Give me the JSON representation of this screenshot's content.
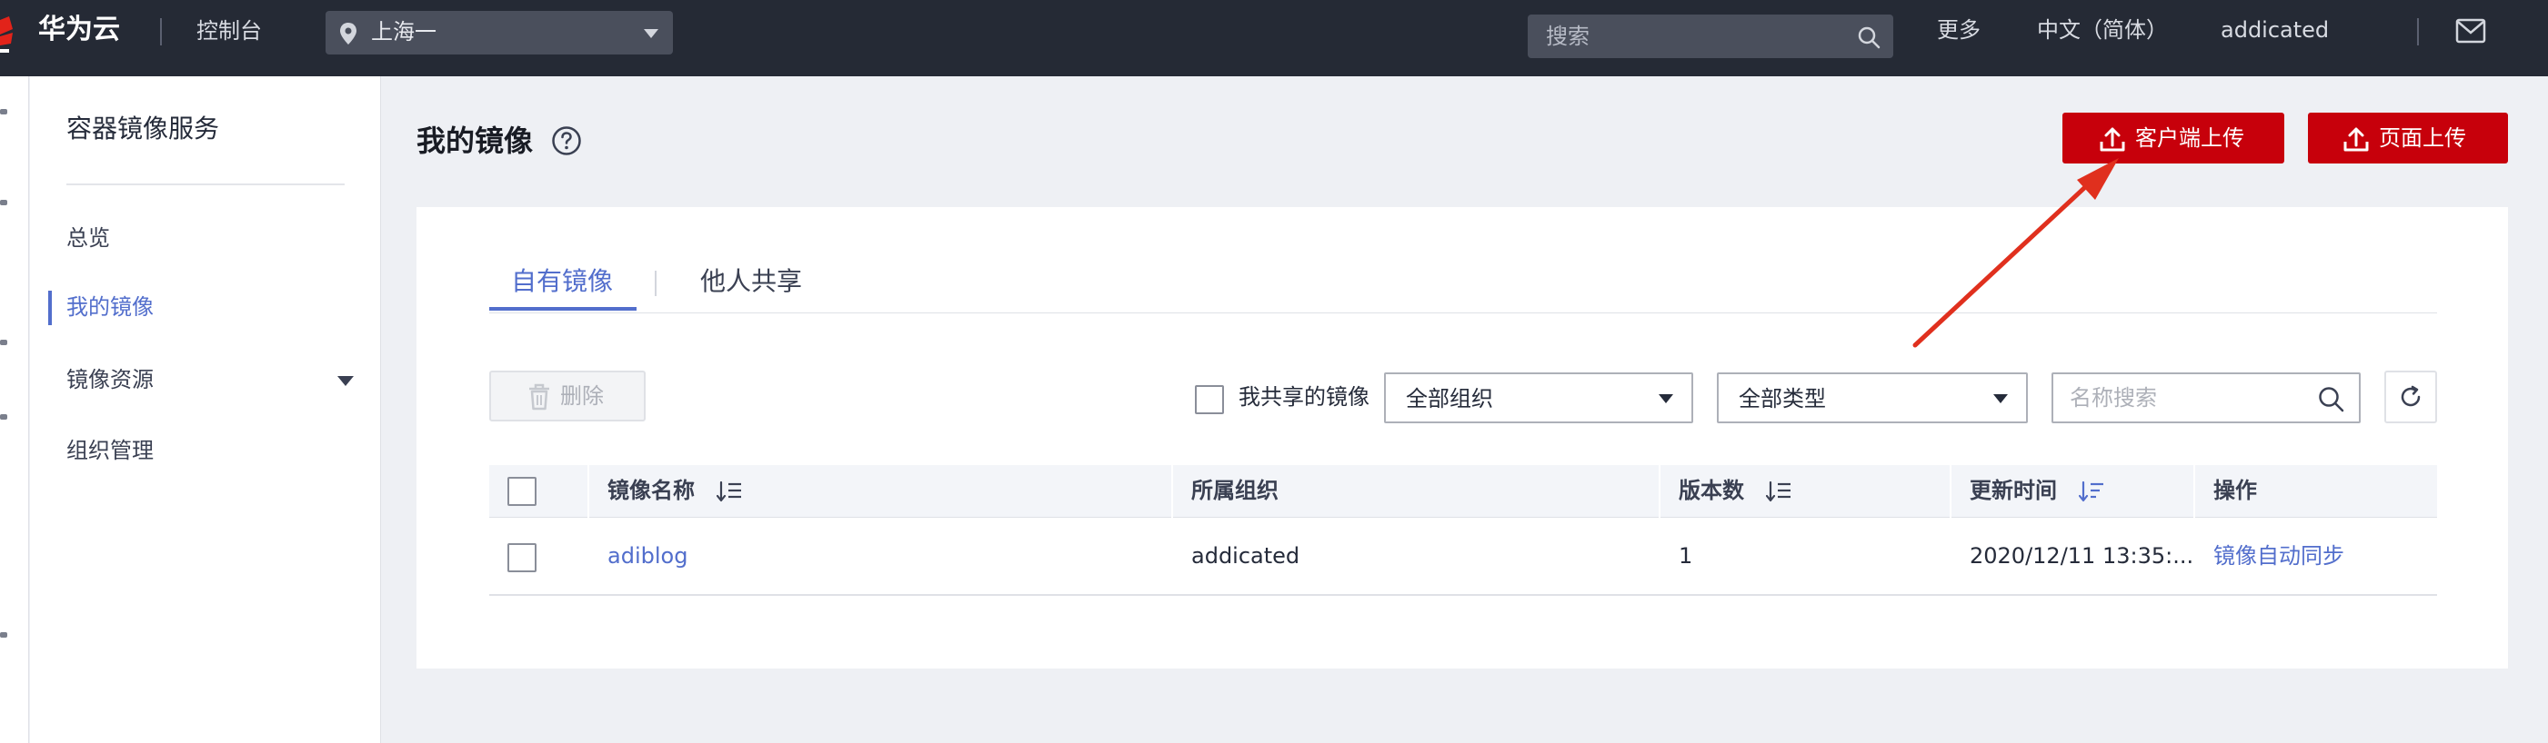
{
  "topbar": {
    "brand": "华为云",
    "console": "控制台",
    "region": "上海一",
    "search_placeholder": "搜索",
    "more": "更多",
    "language": "中文（简体）",
    "user": "addicated"
  },
  "sidebar": {
    "title": "容器镜像服务",
    "items": [
      {
        "label": "总览"
      },
      {
        "label": "我的镜像",
        "active": true
      },
      {
        "label": "镜像资源",
        "expandable": true
      },
      {
        "label": "组织管理"
      }
    ]
  },
  "page": {
    "title": "我的镜像",
    "client_upload": "客户端上传",
    "web_upload": "页面上传"
  },
  "tabs": [
    {
      "label": "自有镜像",
      "active": true
    },
    {
      "label": "他人共享"
    }
  ],
  "toolbar": {
    "delete": "删除",
    "my_shared": "我共享的镜像",
    "org_filter": "全部组织",
    "type_filter": "全部类型",
    "name_search_placeholder": "名称搜索"
  },
  "table": {
    "columns": [
      "镜像名称",
      "所属组织",
      "版本数",
      "更新时间",
      "操作"
    ],
    "rows": [
      {
        "name": "adiblog",
        "org": "addicated",
        "versions": "1",
        "updated": "2020/12/11 13:35:...",
        "action": "镜像自动同步"
      }
    ]
  },
  "colors": {
    "topbar_bg": "#252a35",
    "accent_blue": "#526ecc",
    "brand_red": "#c7000b",
    "annotation_arrow": "#e0301e"
  }
}
